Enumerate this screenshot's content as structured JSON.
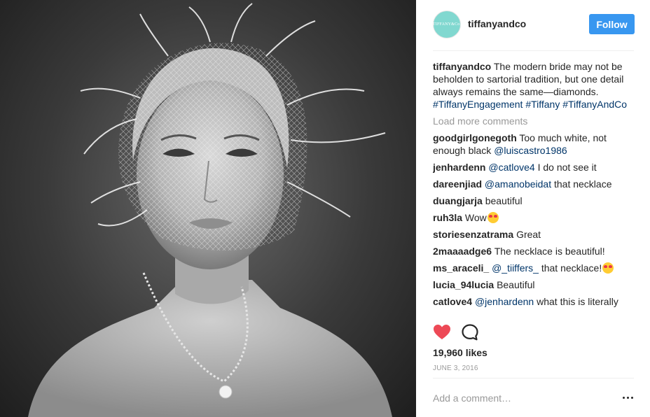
{
  "post": {
    "image_alt": "Black and white portrait of a woman wearing a feathered veil and a diamond necklace"
  },
  "header": {
    "username": "tiffanyandco",
    "avatar_text": "TIFFANY&Co.",
    "follow_label": "Follow"
  },
  "caption": {
    "username": "tiffanyandco",
    "text": "The modern bride may not be beholden to sartorial tradition, but one detail always remains the same—diamonds.",
    "hashtags": [
      "#TiffanyEngagement",
      "#Tiffany",
      "#TiffanyAndCo"
    ]
  },
  "load_more_label": "Load more comments",
  "comments": [
    {
      "username": "goodgirlgonegoth",
      "text_before": "Too much white, not enough black",
      "mention": "@luiscastro1986",
      "text_after": ""
    },
    {
      "username": "jenhardenn",
      "text_before": "",
      "mention": "@catlove4",
      "text_after": "I do not see it"
    },
    {
      "username": "dareenjiad",
      "text_before": "",
      "mention": "@amanobeidat",
      "text_after": "that necklace"
    },
    {
      "username": "duangjarja",
      "text_before": "beautiful",
      "mention": "",
      "text_after": ""
    },
    {
      "username": "ruh3la",
      "text_before": "Wow",
      "mention": "",
      "text_after": "",
      "emoji": "heart-eyes-emoji"
    },
    {
      "username": "storiesenzatrama",
      "text_before": "Great",
      "mention": "",
      "text_after": ""
    },
    {
      "username": "2maaaadge6",
      "text_before": "The necklace is beautiful!",
      "mention": "",
      "text_after": ""
    },
    {
      "username": "ms_araceli_",
      "text_before": "",
      "mention": "@_tiiffers_",
      "text_after": "that necklace!",
      "emoji": "heart-eyes-emoji"
    },
    {
      "username": "lucia_94lucia",
      "text_before": "Beautiful",
      "mention": "",
      "text_after": ""
    },
    {
      "username": "catlove4",
      "text_before": "",
      "mention": "@jenhardenn",
      "text_after": "what this is literally"
    }
  ],
  "actions": {
    "like_icon": "heart-icon",
    "like_color": "#ed4956",
    "comment_icon": "comment-bubble-icon"
  },
  "likes_label": "19,960 likes",
  "date_label": "JUNE 3, 2016",
  "add_comment": {
    "placeholder": "Add a comment…",
    "value": ""
  },
  "colors": {
    "follow_button": "#3897f0",
    "hashtag": "#003569",
    "avatar_bg": "#81d8d0"
  }
}
